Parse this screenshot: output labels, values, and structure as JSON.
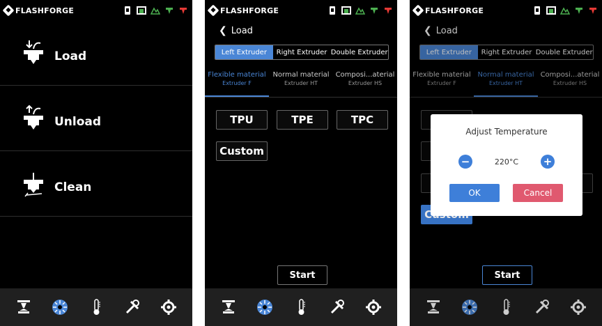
{
  "brand": "FLASHFORGE",
  "colors": {
    "accent": "#4a86d6",
    "cancel": "#e0596f",
    "ok": "#3e7fd9",
    "dialog_bg": "#ffffff"
  },
  "status_icons": [
    "sd-card-icon",
    "printer-icon",
    "filament-icon",
    "extruder-left-warning-icon",
    "extruder-right-error-icon"
  ],
  "screens": {
    "load_menu": {
      "items": [
        {
          "label": "Load",
          "icon": "load-filament-icon"
        },
        {
          "label": "Unload",
          "icon": "unload-filament-icon"
        },
        {
          "label": "Clean",
          "icon": "clean-nozzle-icon"
        }
      ]
    },
    "material_select": {
      "back_label": "Load",
      "extruder_tabs": [
        "Left Extruder",
        "Right Extruder",
        "Double Extruder"
      ],
      "material_tabs": [
        {
          "title": "Flexible material",
          "subtitle": "Extruder F"
        },
        {
          "title": "Normal material",
          "subtitle": "Extruder HT"
        },
        {
          "title": "Composi...aterial",
          "subtitle": "Extruder HS"
        }
      ],
      "materials": [
        "TPU",
        "TPE",
        "TPC"
      ],
      "custom_label": "Custom",
      "start_label": "Start"
    },
    "temperature_dialog": {
      "back_label": "Load",
      "extruder_tabs": [
        "Left Extruder",
        "Right Extruder",
        "Double Extruder"
      ],
      "material_tabs": [
        {
          "title": "Flexible material",
          "subtitle": "Extruder F"
        },
        {
          "title": "Normal material",
          "subtitle": "Extruder HT"
        },
        {
          "title": "Composi...aterial",
          "subtitle": "Extruder HS"
        }
      ],
      "custom_label_partial": "Custom",
      "start_label": "Start",
      "dialog": {
        "title": "Adjust Temperature",
        "minus": "−",
        "plus": "+",
        "value": "220°C",
        "ok": "OK",
        "cancel": "Cancel"
      }
    }
  },
  "bottom_nav": [
    "print-icon",
    "filament-spool-icon",
    "thermometer-icon",
    "tools-icon",
    "settings-icon"
  ]
}
